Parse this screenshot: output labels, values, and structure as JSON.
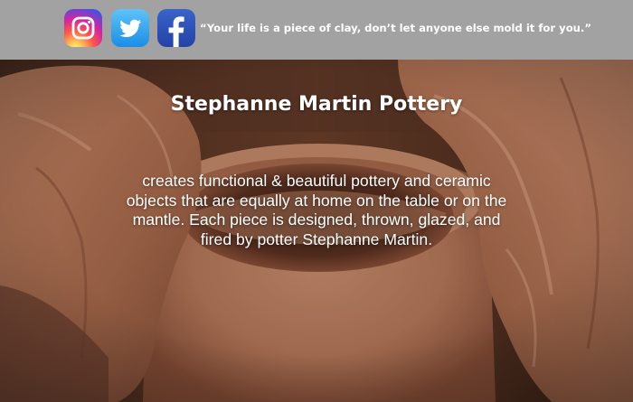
{
  "header": {
    "social": [
      {
        "name": "instagram-icon",
        "color": "#d6249f"
      },
      {
        "name": "twitter-icon",
        "color": "#1da1f2"
      },
      {
        "name": "facebook-icon",
        "color": "#1877f2"
      }
    ],
    "quote": "“Your life is a piece of clay, don’t let anyone else mold it for you.”"
  },
  "hero": {
    "title": "Stephanne Martin Pottery",
    "description": "creates functional & beautiful pottery and ceramic objects that are equally at home on the table or on the mantle. Each piece is designed, thrown, glazed, and fired by potter Stephanne Martin."
  },
  "colors": {
    "topbar": "#a2a2a2",
    "clay": "#b5785a"
  }
}
